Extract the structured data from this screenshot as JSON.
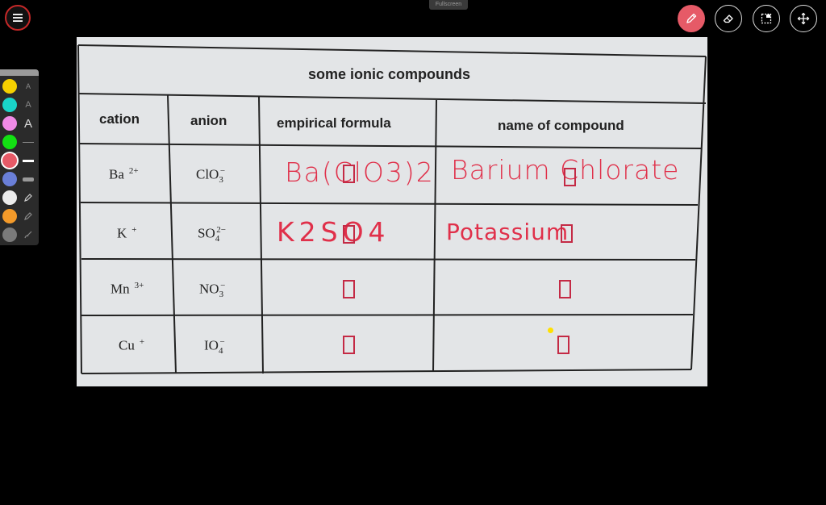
{
  "window": {
    "top_caption": "Fullscreen"
  },
  "toolbar": {
    "menu_icon": "hamburger-menu-icon",
    "tools": [
      {
        "name": "pen-tool",
        "icon": "pencil-icon",
        "active": true
      },
      {
        "name": "eraser-tool",
        "icon": "eraser-icon",
        "active": false
      },
      {
        "name": "select-tool",
        "icon": "dashed-select-icon",
        "active": false
      },
      {
        "name": "move-tool",
        "icon": "move-arrows-icon",
        "active": false
      }
    ]
  },
  "palette": {
    "colors": [
      "#f5d000",
      "#19d4c8",
      "#f08ae6",
      "#13e013",
      "#e65a67",
      "#6a7fd8",
      "#ececec",
      "#f39a2a",
      "#7a7a7a"
    ],
    "text_labels": [
      "A",
      "A",
      "A"
    ]
  },
  "table": {
    "title": "some ionic compounds",
    "headers": [
      "cation",
      "anion",
      "empirical formula",
      "name of compound"
    ],
    "rows": [
      {
        "cation": "Ba",
        "cation_charge": "2+",
        "anion_base": "ClO",
        "anion_sub": "3",
        "anion_charge": "−",
        "formula": "Ba(ClO3)2",
        "name": "Barium Chlorate"
      },
      {
        "cation": "K",
        "cation_charge": "+",
        "anion_base": "SO",
        "anion_sub": "4",
        "anion_charge": "2−",
        "formula": "K2SO4",
        "name": "Potassium"
      },
      {
        "cation": "Mn",
        "cation_charge": "3+",
        "anion_base": "NO",
        "anion_sub": "3",
        "anion_charge": "−",
        "formula": "",
        "name": ""
      },
      {
        "cation": "Cu",
        "cation_charge": "+",
        "anion_base": "IO",
        "anion_sub": "4",
        "anion_charge": "−",
        "formula": "",
        "name": ""
      }
    ]
  },
  "handwriting": {
    "ink_color": "#e0304a",
    "row1_formula": "Ba(ClO3)2",
    "row1_name": "Barium Chlorate",
    "row2_formula": "K2SO4",
    "row2_name": "Potassium"
  },
  "pointer": {
    "color": "#ffe000"
  }
}
